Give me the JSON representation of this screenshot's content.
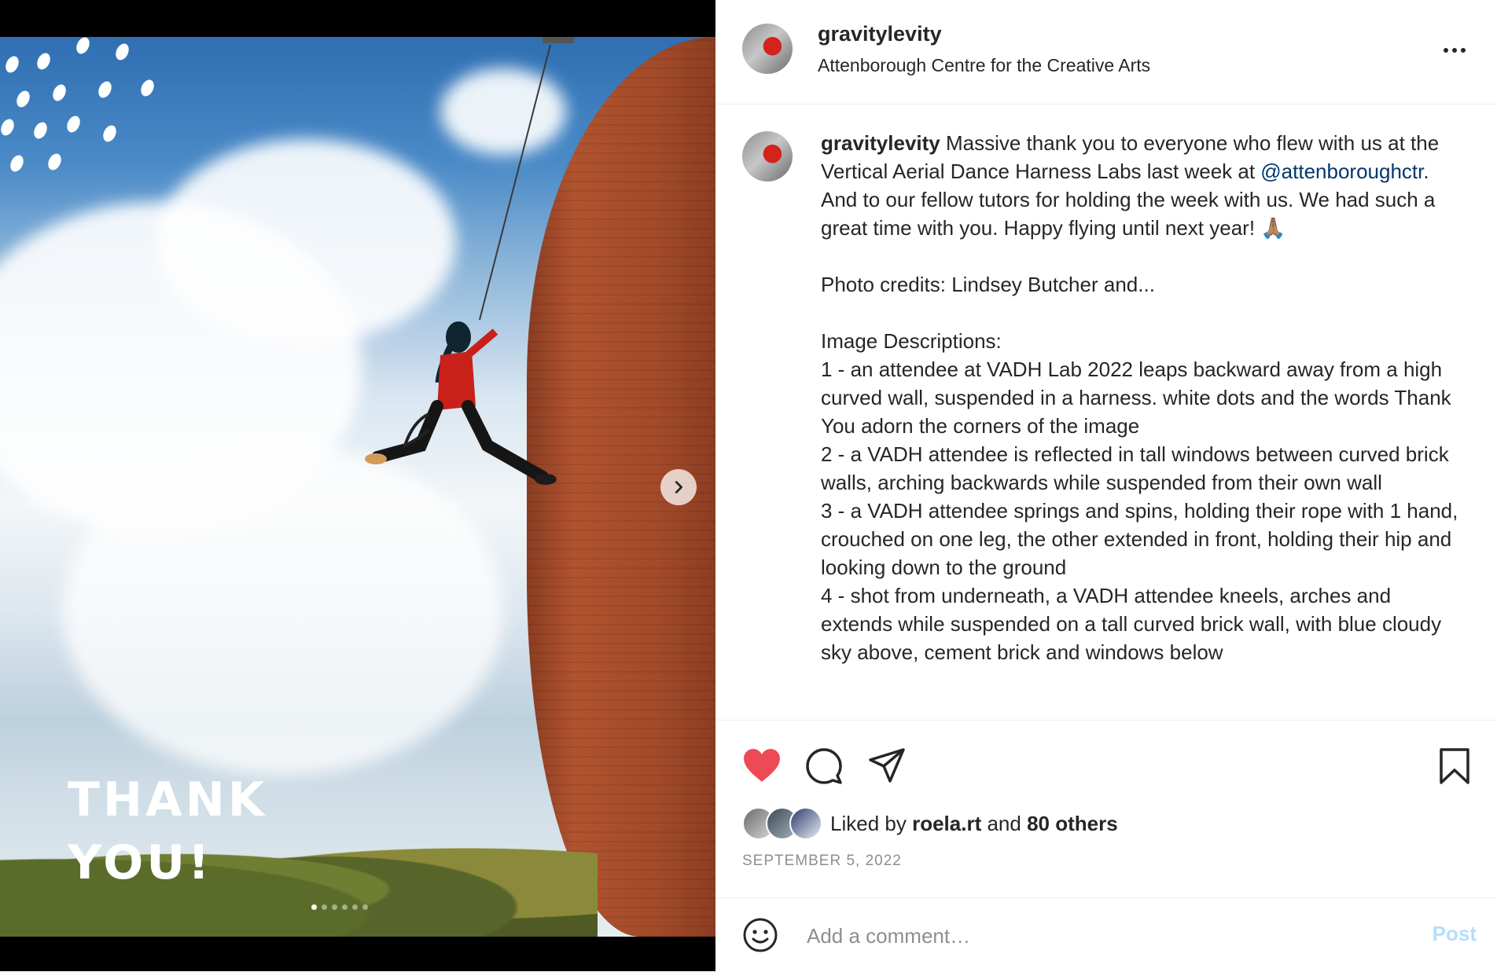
{
  "post": {
    "username": "gravitylevity",
    "location": "Attenborough Centre for the Creative Arts",
    "more_icon": "more-horizontal-icon"
  },
  "media": {
    "overlay_text": "THANK\nYOU!",
    "slide_count": 6,
    "active_slide": 1,
    "next_icon": "chevron-right-icon"
  },
  "caption": {
    "username": "gravitylevity",
    "text_before_mention": " Massive thank you to everyone who flew with us at the Vertical Aerial Dance Harness Labs last week at ",
    "mention": "@attenboroughctr",
    "text_after_mention": ". And to our fellow tutors for holding the week with us. We had such a great time with you. Happy flying until next year! 🙏🏽\n\nPhoto credits: Lindsey Butcher and...\n\nImage Descriptions:\n1 - an attendee at VADH Lab 2022 leaps backward away from a high curved wall, suspended in a harness. white dots and the words Thank You adorn the corners of the image\n2 - a VADH attendee is reflected in tall windows between curved brick walls, arching backwards while suspended from their own wall\n3 - a VADH attendee springs and spins, holding their rope with 1 hand, crouched on one leg, the other extended in front, holding their hip and looking down to the ground\n4 - shot from underneath, a VADH attendee kneels, arches and extends while suspended on a tall curved brick wall, with blue cloudy sky above, cement brick and windows below"
  },
  "actions": {
    "like_icon": "heart-filled-icon",
    "comment_icon": "comment-icon",
    "share_icon": "paper-plane-icon",
    "save_icon": "bookmark-icon",
    "like_color": "#ed4956"
  },
  "likes": {
    "prefix": "Liked by",
    "first_user": "roela.rt",
    "joiner": "and",
    "others": "80 others"
  },
  "date": "SEPTEMBER 5, 2022",
  "comment_box": {
    "emoji_icon": "smiley-icon",
    "placeholder": "Add a comment…",
    "post_label": "Post"
  }
}
